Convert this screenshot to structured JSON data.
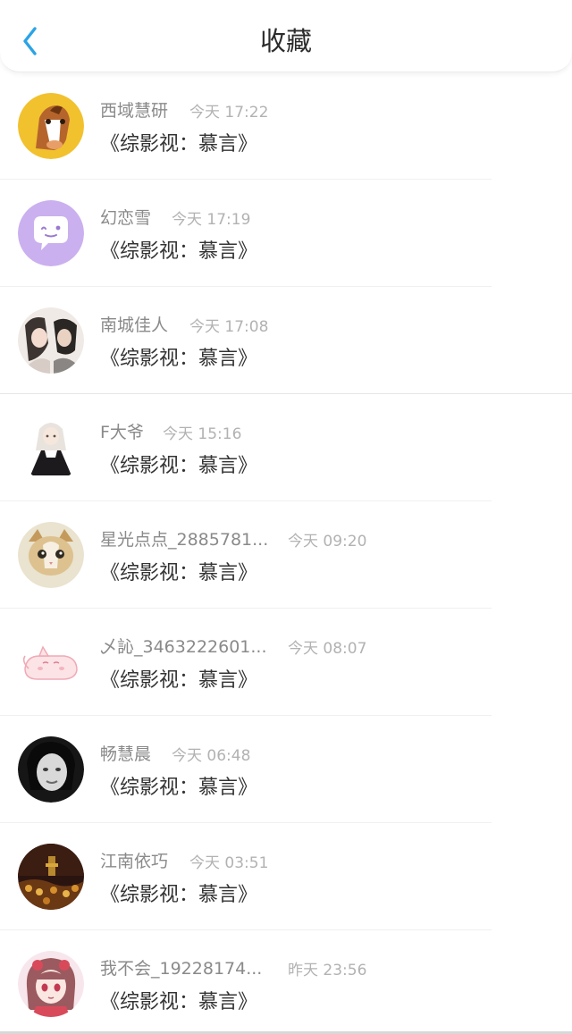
{
  "header": {
    "title": "收藏",
    "back_icon": "chevron-left-icon",
    "accent_color": "#2ba3e6"
  },
  "items": [
    {
      "name": "西域慧研",
      "time": "今天 17:22",
      "book": "《综影视：慕言》",
      "avatar": "cartoon-horse"
    },
    {
      "name": "幻恋雪",
      "time": "今天 17:19",
      "book": "《综影视：慕言》",
      "avatar": "purple-chat-bubble"
    },
    {
      "name": "南城佳人",
      "time": "今天 17:08",
      "book": "《综影视：慕言》",
      "avatar": "couple-photo"
    },
    {
      "name": "F大爷",
      "time": "今天 15:16",
      "book": "《综影视：慕言》",
      "avatar": "anime-girl-dark-dress"
    },
    {
      "name": "星光点点_2885781...",
      "time": "今天 09:20",
      "book": "《综影视：慕言》",
      "avatar": "kitten-photo"
    },
    {
      "name": "乄訫_3463222601...",
      "time": "今天 08:07",
      "book": "《综影视：慕言》",
      "avatar": "pink-cat-drawing"
    },
    {
      "name": "畅慧晨",
      "time": "今天 06:48",
      "book": "《综影视：慕言》",
      "avatar": "bw-portrait"
    },
    {
      "name": "江南依巧",
      "time": "今天 03:51",
      "book": "《综影视：慕言》",
      "avatar": "dark-scenery"
    },
    {
      "name": "我不会_19228174...",
      "time": "昨天 23:56",
      "book": "《综影视：慕言》",
      "avatar": "anime-girl-pink"
    }
  ]
}
